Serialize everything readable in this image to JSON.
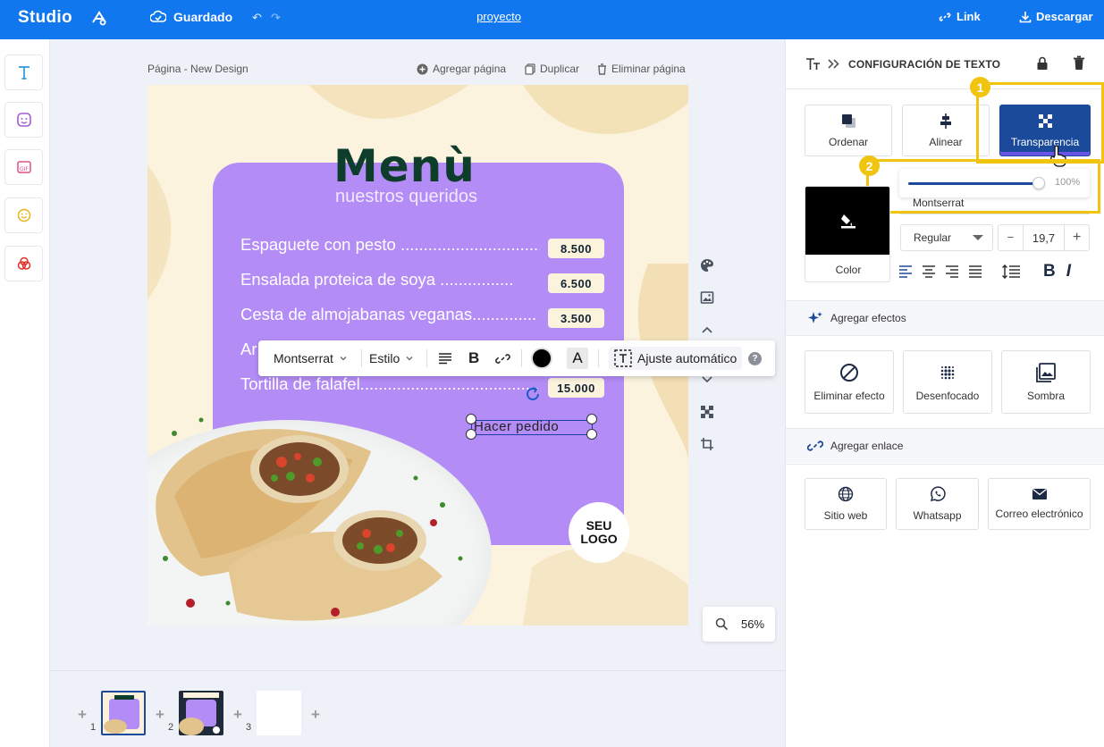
{
  "topbar": {
    "logo": "Studio",
    "saved_label": "Guardado",
    "project": "proyecto",
    "link_label": "Link",
    "download_label": "Descargar"
  },
  "left_tools": [
    "text-tool",
    "sticker-tool",
    "gif-tool",
    "emoji-tool",
    "color-tool"
  ],
  "canvas": {
    "page_label": "Página - New Design",
    "add_page": "Agregar página",
    "duplicate": "Duplicar",
    "delete_page": "Eliminar página",
    "zoom": "56%"
  },
  "design": {
    "title": "Menù",
    "subtitle": "nuestros queridos",
    "items": [
      {
        "name": "Espaguete con pesto ..................................",
        "price": "8.500"
      },
      {
        "name": "Ensalada proteica de soya ......................",
        "price": "6.500"
      },
      {
        "name": "Cesta de almojabanas veganas..............",
        "price": "3.500"
      },
      {
        "name": "Ar",
        "price": ""
      },
      {
        "name": "Tortilla de falafel.........................................",
        "price": "15.000"
      }
    ],
    "selected_text": "Hacer pedido",
    "logo_text": "SEU LOGO"
  },
  "text_toolbar": {
    "font": "Montserrat",
    "style": "Estilo",
    "auto_fit": "Ajuste automático",
    "help": "?"
  },
  "thumbnails": {
    "pages": [
      "1",
      "2",
      "3"
    ]
  },
  "panel": {
    "title": "CONFIGURACIÓN DE TEXTO",
    "buttons": {
      "order": "Ordenar",
      "align": "Alinear",
      "transparency": "Transparencia"
    },
    "badges": [
      "1",
      "2"
    ],
    "transparency_value": "100%",
    "transparency_level": 1.0,
    "color_label": "Color",
    "font": "Montserrat",
    "weight": "Regular",
    "size": "19,7",
    "size_minus": "−",
    "size_plus": "+",
    "bold": "B",
    "italic": "I",
    "effects_header": "Agregar efectos",
    "effects": {
      "none": "Eliminar efecto",
      "blur": "Desenfocado",
      "shadow": "Sombra"
    },
    "link_header": "Agregar enlace",
    "links": {
      "web": "Sitio web",
      "whatsapp": "Whatsapp",
      "email": "Correo electrónico"
    }
  },
  "colors": {
    "brand": "#1177ee",
    "active_button": "#1b4a9b",
    "highlight": "#f1c40f",
    "menu_card": "#b48cf6",
    "menu_title": "#0f3d2c"
  }
}
